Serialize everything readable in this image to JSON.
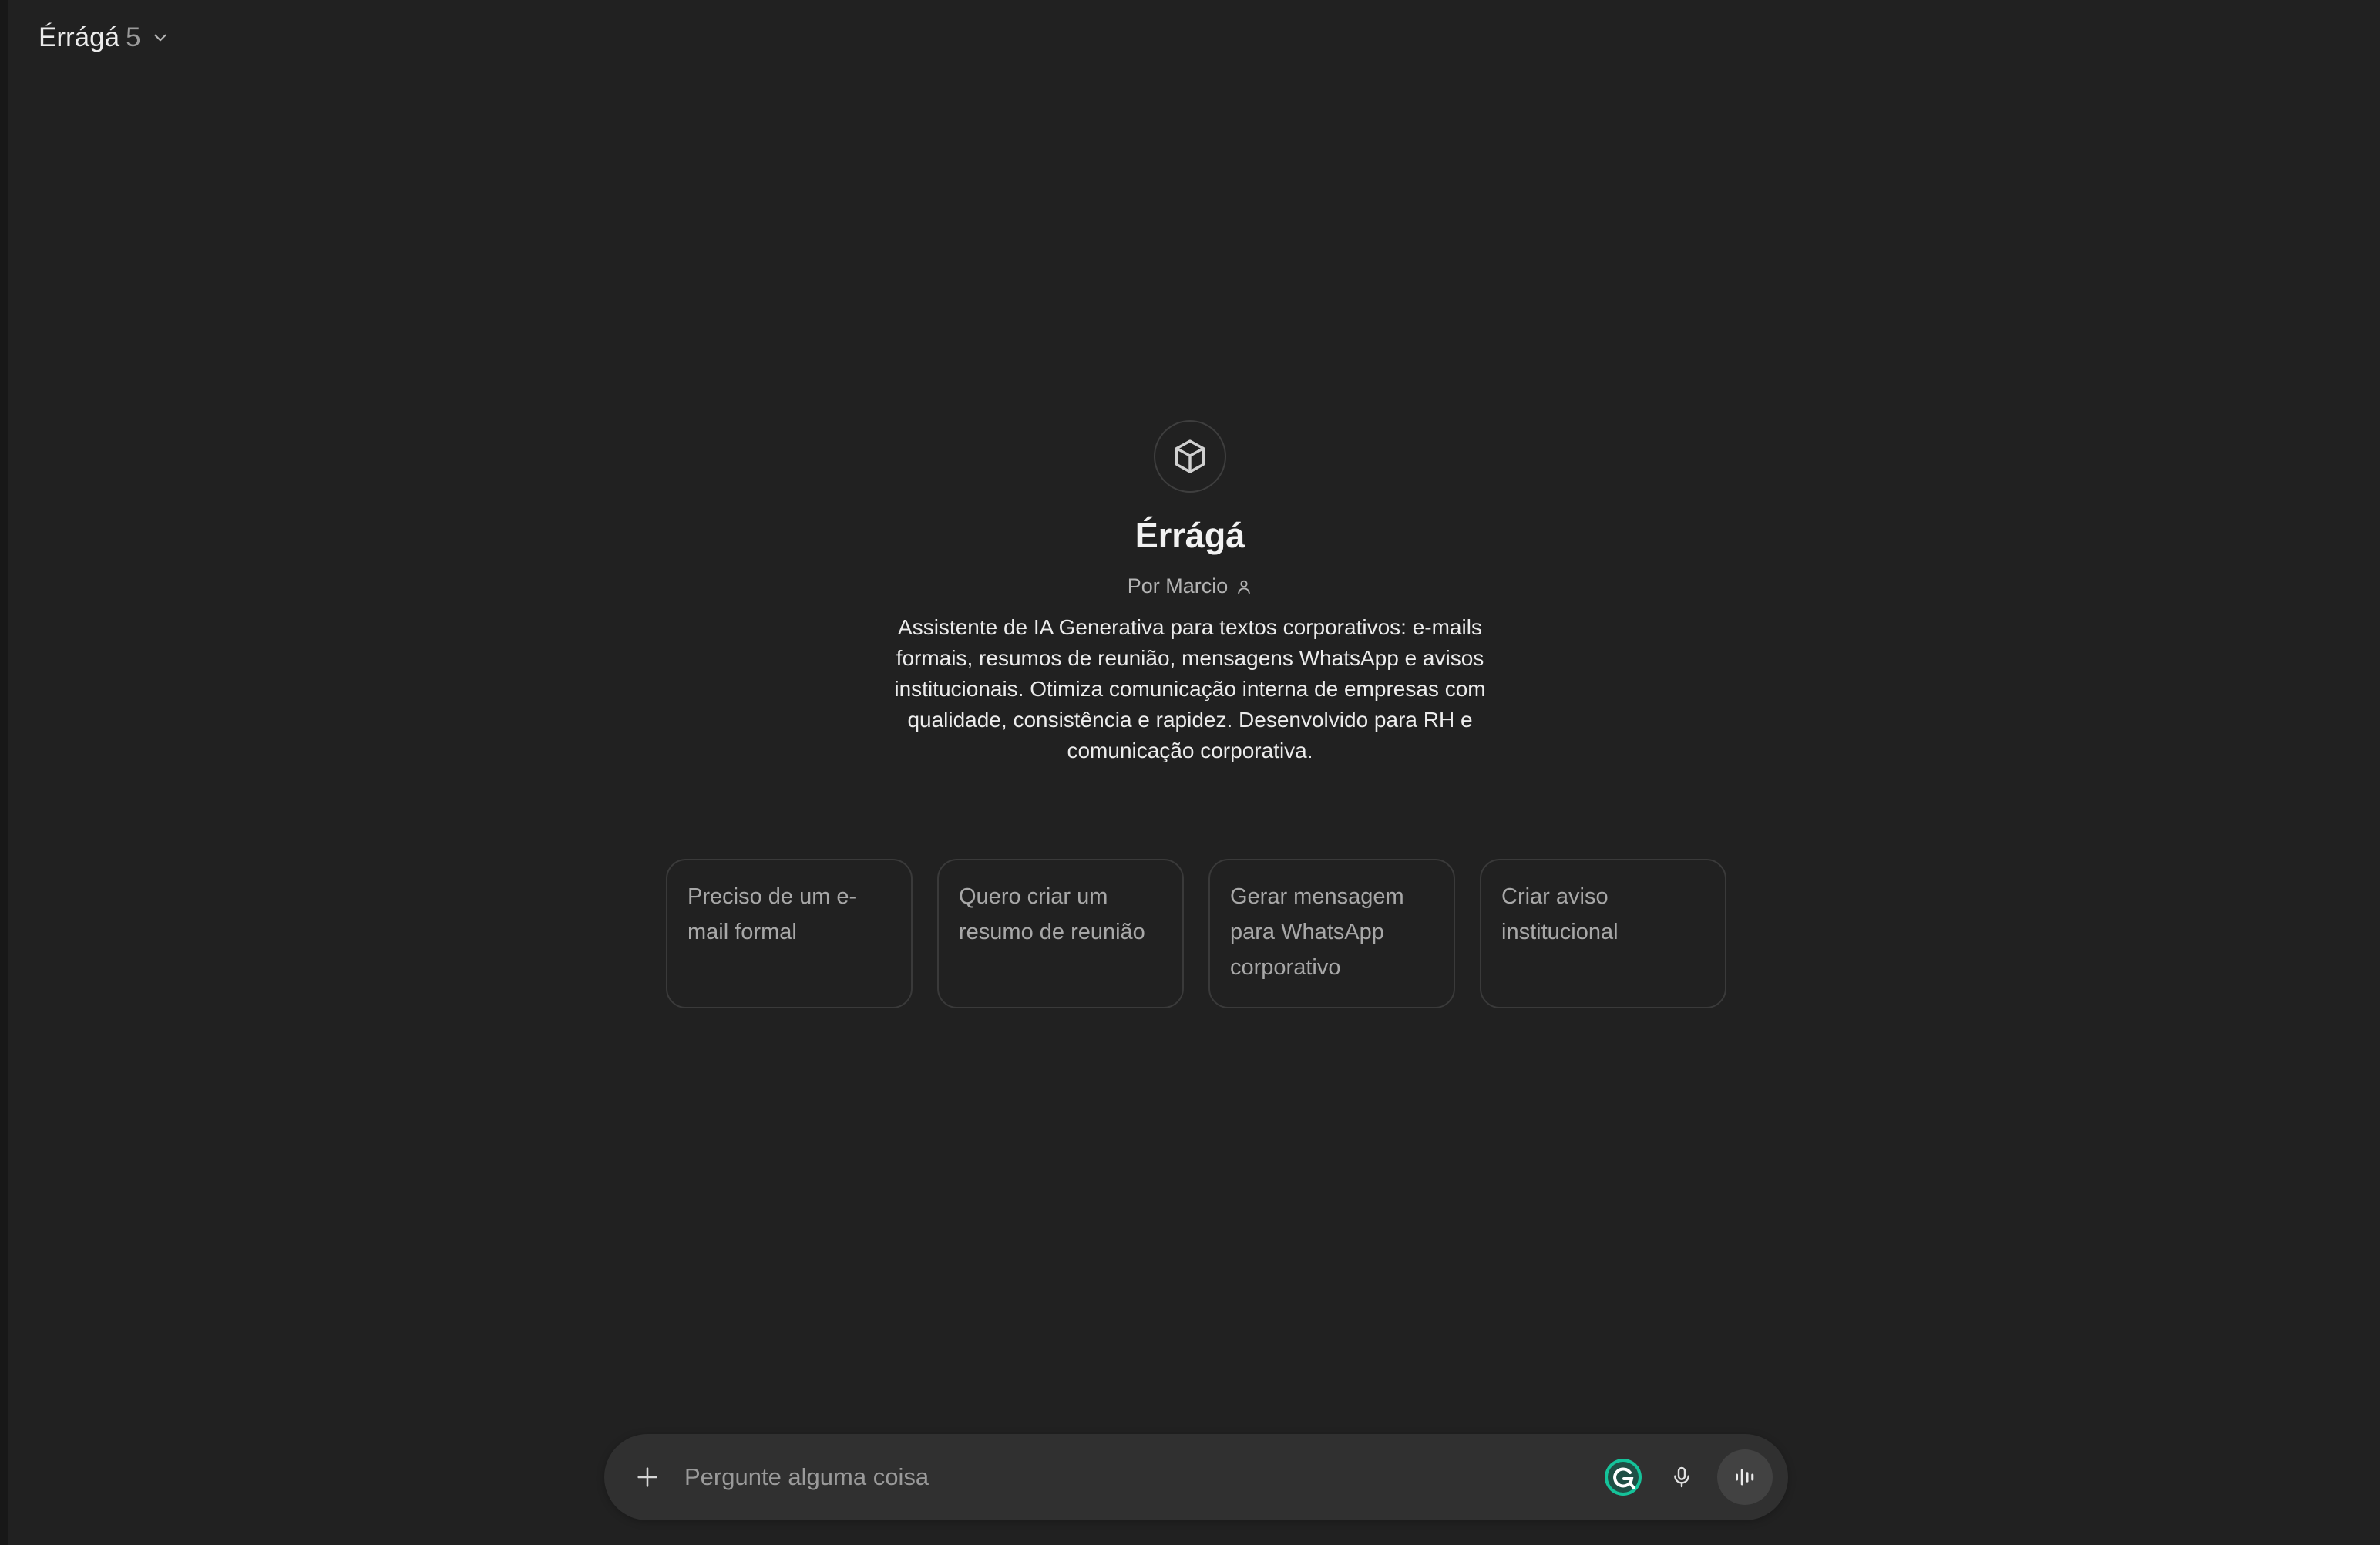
{
  "header": {
    "model_name": "Érrágá",
    "model_version": "5"
  },
  "gpt": {
    "icon": "cube-icon",
    "title": "Érrágá",
    "byline": "Por Marcio",
    "description": "Assistente de IA Generativa para textos corporativos: e-mails formais, resumos de reunião, mensagens WhatsApp e avisos institucionais. Otimiza comunicação interna de empresas com qualidade, consistência e rapidez. Desenvolvido para RH e comunicação corporativa."
  },
  "suggestions": [
    {
      "label": "Preciso de um e-mail formal"
    },
    {
      "label": "Quero criar um resumo de reunião"
    },
    {
      "label": "Gerar mensagem para WhatsApp corporativo"
    },
    {
      "label": "Criar aviso institucional"
    }
  ],
  "composer": {
    "placeholder": "Pergunte alguma coisa",
    "value": ""
  },
  "colors": {
    "background": "#212121",
    "composer_bg": "#303030",
    "grammarly_green": "#15c39a"
  }
}
